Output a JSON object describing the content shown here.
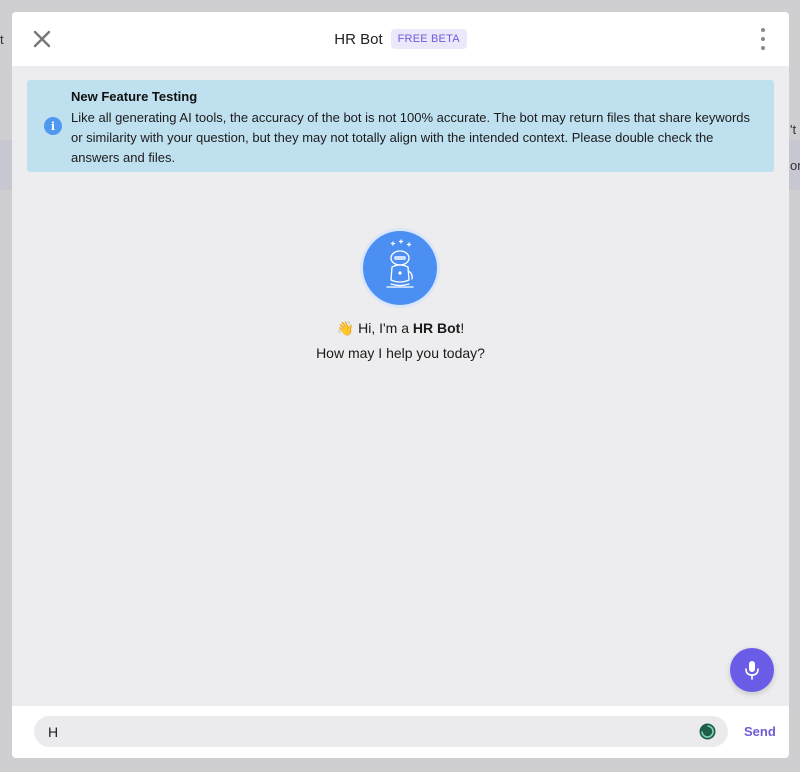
{
  "background": {
    "fragment_left": "t",
    "fragment_right_1": "'t",
    "fragment_right_2": "or"
  },
  "header": {
    "title": "HR Bot",
    "badge": "FREE BETA",
    "close_icon": "close-icon",
    "more_icon": "more-vertical-icon"
  },
  "notice": {
    "icon": "info-icon",
    "icon_glyph": "i",
    "title": "New Feature Testing",
    "body": "Like all generating AI tools, the accuracy of the bot is not 100% accurate. The bot may return files that share keywords or similarity with your question, but they may not totally align with the intended context. Please double check the answers and files."
  },
  "welcome": {
    "avatar_icon": "robot-icon",
    "wave_emoji": "👋",
    "greeting_prefix": "Hi, I'm a ",
    "bot_name": "HR Bot",
    "greeting_suffix": "!",
    "subtitle": "How may I help you today?"
  },
  "composer": {
    "input_value": "H",
    "send_label": "Send",
    "mic_icon": "microphone-icon",
    "status_icon": "loading-indicator-icon"
  },
  "colors": {
    "accent": "#6b5ce7",
    "notice_bg": "#bfe0ef",
    "avatar_bg": "#4b8ff2"
  }
}
